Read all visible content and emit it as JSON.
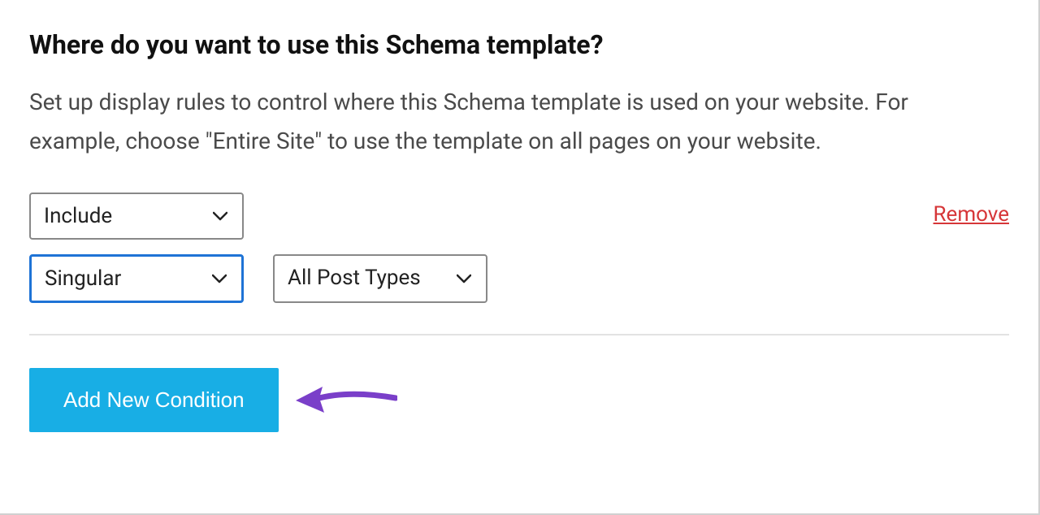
{
  "heading": "Where do you want to use this Schema template?",
  "description": "Set up display rules to control where this Schema template is used on your website. For example, choose \"Entire Site\" to use the template on all pages on your website.",
  "rule": {
    "include_select": "Include",
    "scope_select": "Singular",
    "posttype_select": "All Post Types",
    "remove_label": "Remove"
  },
  "add_button_label": "Add New Condition"
}
